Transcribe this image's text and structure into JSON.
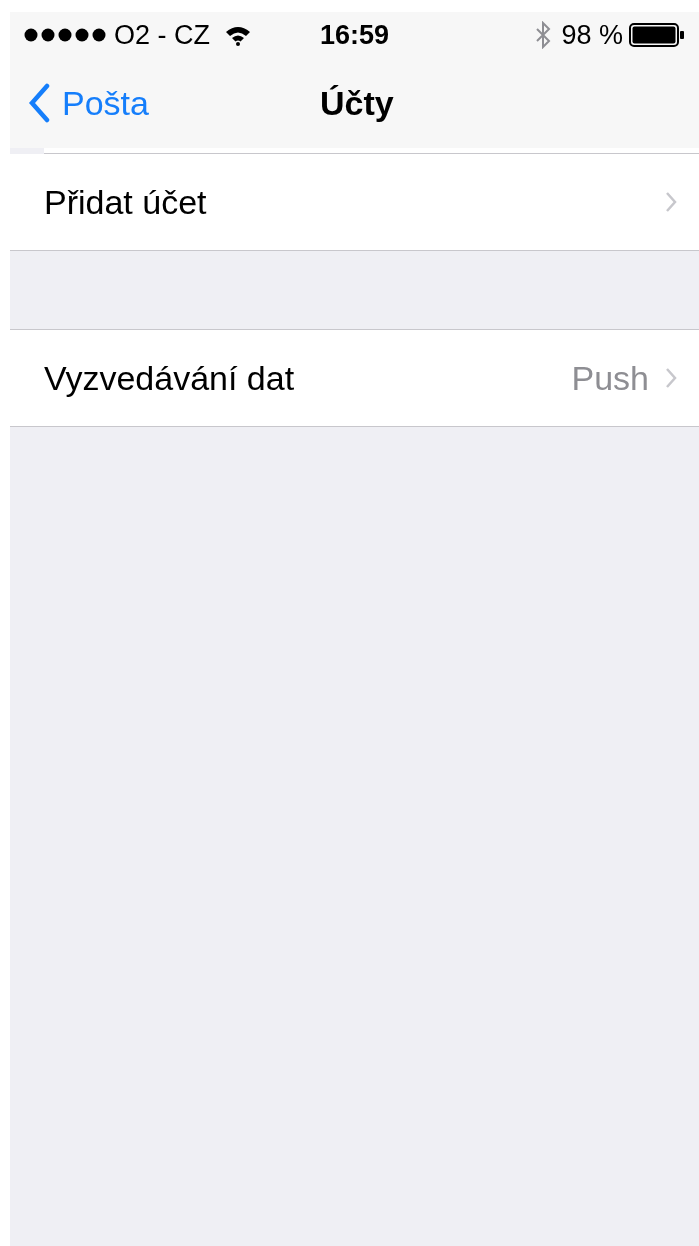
{
  "status_bar": {
    "carrier": "O2 - CZ",
    "time": "16:59",
    "battery": "98 %"
  },
  "nav_bar": {
    "back": "Pošta",
    "title": "Účty"
  },
  "sections": [
    {
      "rows": [
        {
          "label": "Přidat účet"
        }
      ]
    },
    {
      "rows": [
        {
          "label": "Vyzvedávání dat",
          "value": "Push"
        }
      ]
    }
  ]
}
